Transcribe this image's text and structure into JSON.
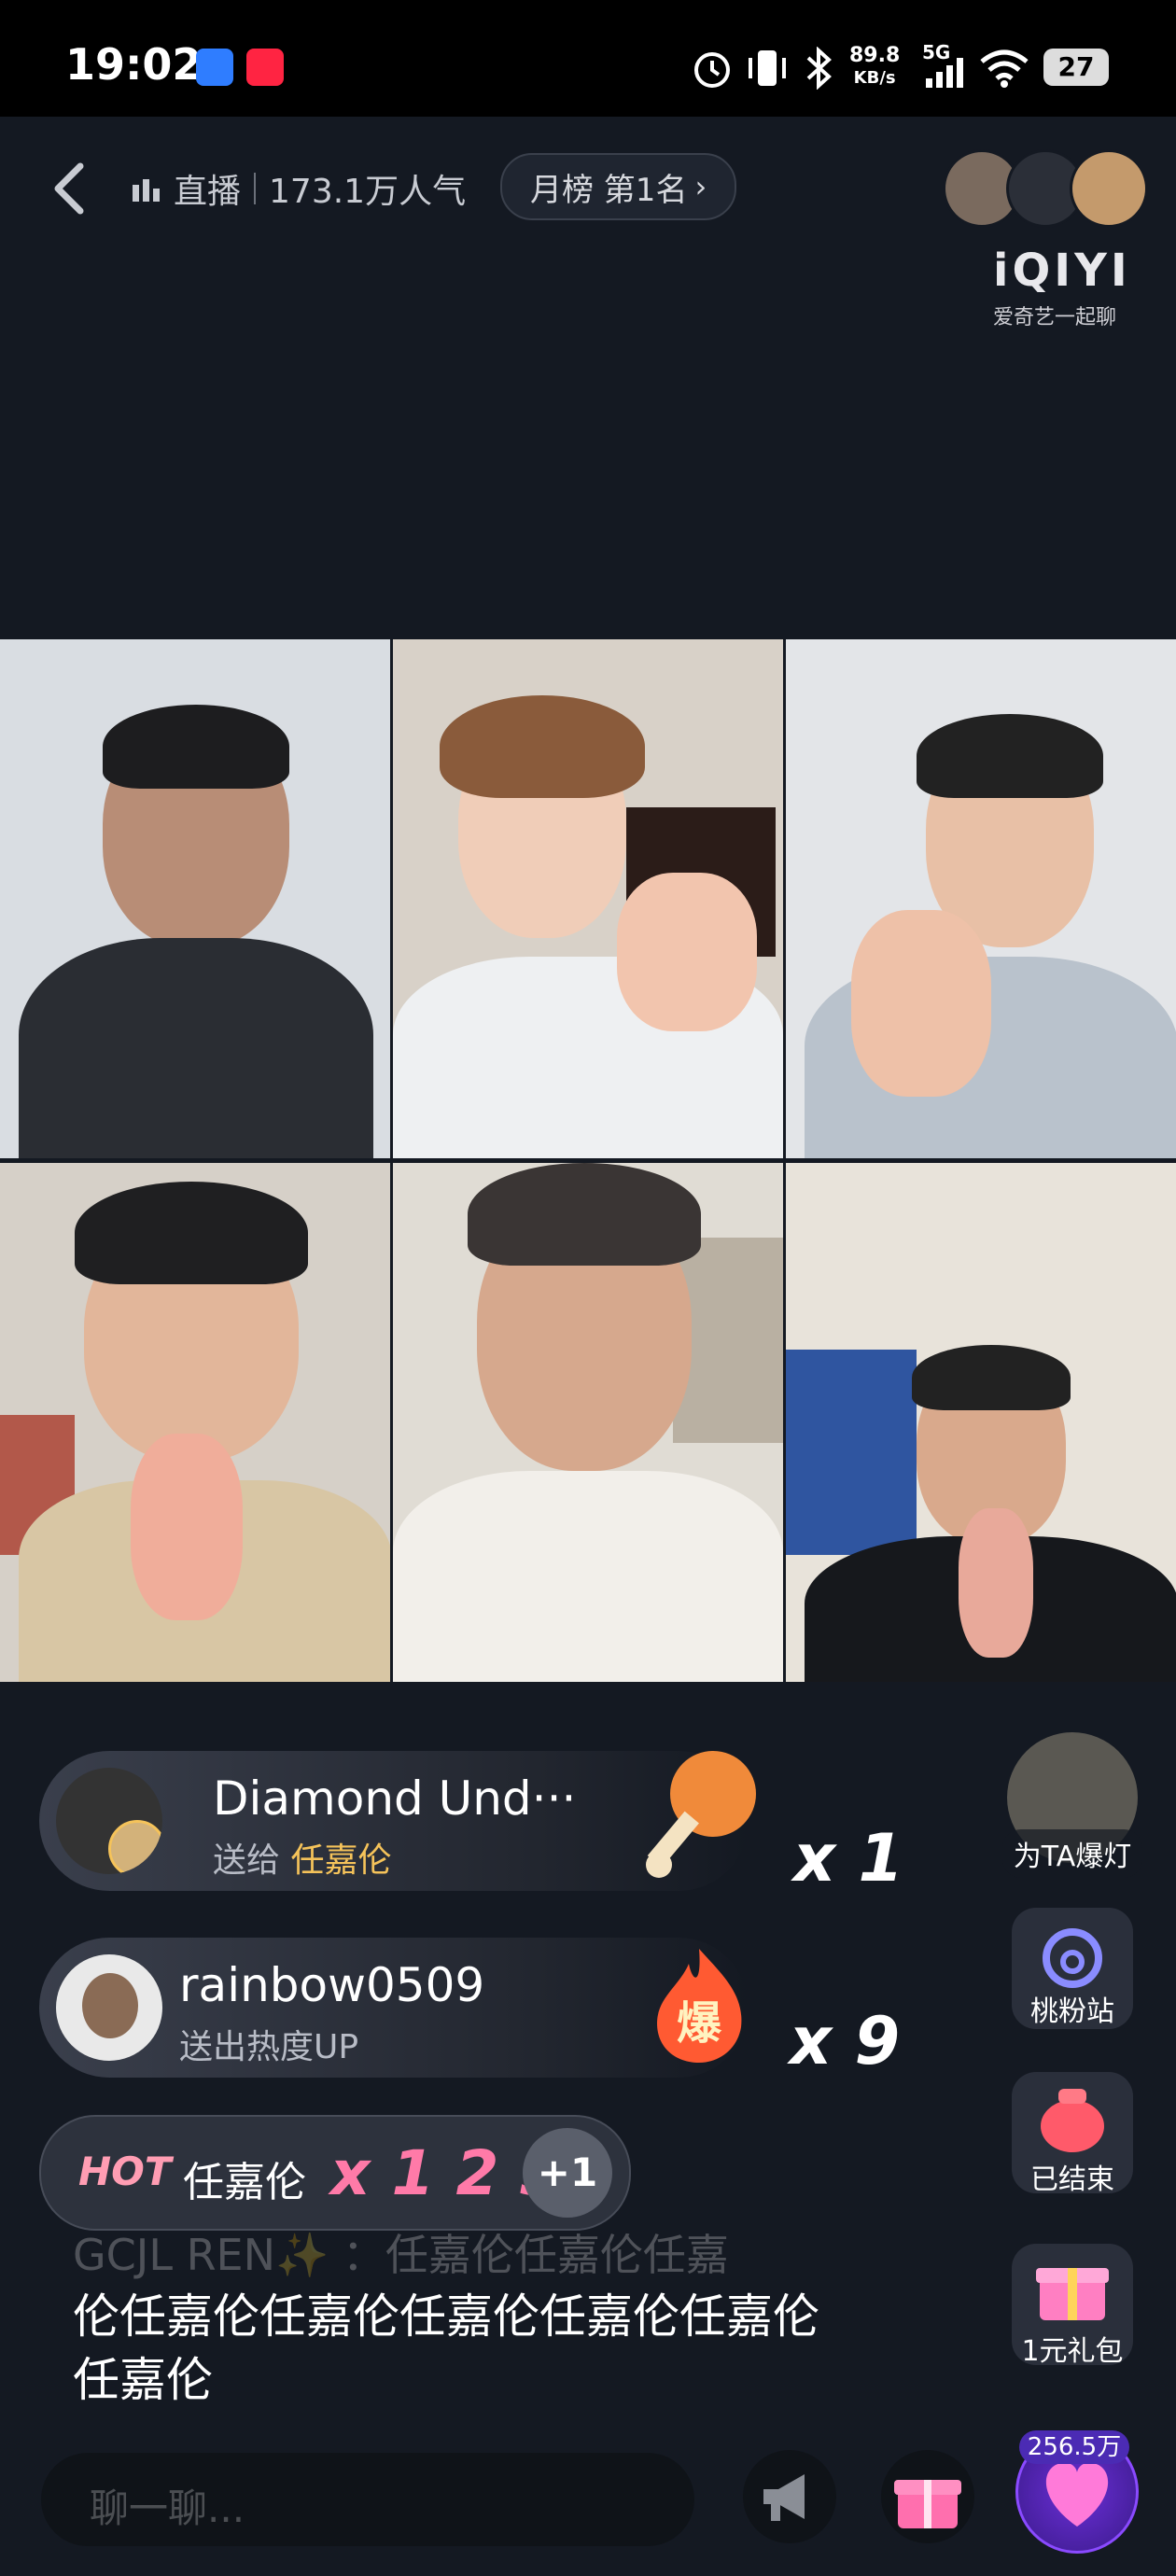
{
  "status_bar": {
    "time": "19:02",
    "network_speed": "89.8",
    "network_unit": "KB/s",
    "signal": "5G",
    "battery": "27"
  },
  "header": {
    "live_label": "直播",
    "popularity": "173.1万人气",
    "rank_label": "月榜 第1名",
    "logo_text": "iQIYI",
    "logo_sub": "爱奇艺一起聊"
  },
  "gifts": [
    {
      "sender": "Diamond Und···",
      "action": "送给",
      "target": "任嘉伦",
      "multiplier": "x 1"
    },
    {
      "sender": "rainbow0509",
      "action": "送出热度UP",
      "target": "",
      "multiplier": "x 9"
    }
  ],
  "hot": {
    "tag": "HOT",
    "name": "任嘉伦",
    "count": "x 1 2 3",
    "plus": "+1"
  },
  "chat": {
    "faded_line": "GCJL REN✨ ：任嘉伦任嘉伦任嘉",
    "line1": "伦任嘉伦任嘉伦任嘉伦任嘉伦任嘉伦",
    "line2": "任嘉伦"
  },
  "side": {
    "spotlight_label": "为TA爆灯",
    "fan_station_label": "桃粉站",
    "ended_label": "已结束",
    "gift_pack_label": "1元礼包",
    "likes_count": "256.5万"
  },
  "bottom": {
    "input_placeholder": "聊一聊..."
  },
  "colors": {
    "background": "#141922",
    "gift_target": "#f5c35a",
    "hot_pink": "#ff7aa8"
  }
}
